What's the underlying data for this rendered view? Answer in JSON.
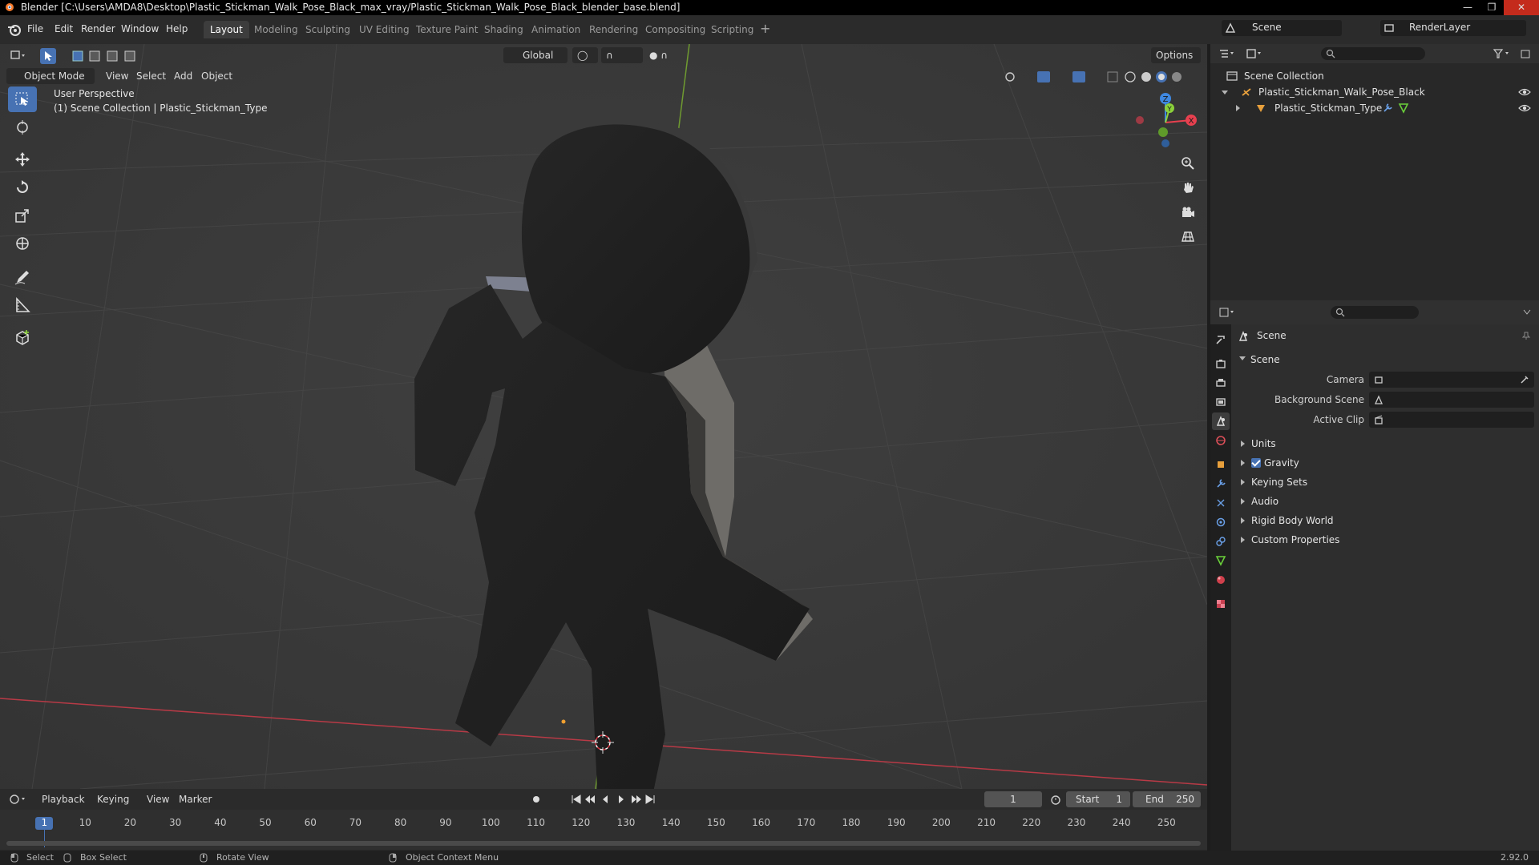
{
  "window": {
    "title": "Blender [C:\\Users\\AMDA8\\Desktop\\Plastic_Stickman_Walk_Pose_Black_max_vray/Plastic_Stickman_Walk_Pose_Black_blender_base.blend]"
  },
  "menu": {
    "items": [
      "File",
      "Edit",
      "Render",
      "Window",
      "Help"
    ]
  },
  "workspaces": {
    "tabs": [
      "Layout",
      "Modeling",
      "Sculpting",
      "UV Editing",
      "Texture Paint",
      "Shading",
      "Animation",
      "Rendering",
      "Compositing",
      "Scripting"
    ],
    "active": "Layout"
  },
  "scene_selector": {
    "scene": "Scene",
    "view_layer": "RenderLayer"
  },
  "viewport": {
    "mode": "Object Mode",
    "menus": [
      "View",
      "Select",
      "Add",
      "Object"
    ],
    "transform_orientation": "Global",
    "options_label": "Options",
    "overlay_line1": "User Perspective",
    "overlay_line2": "(1) Scene Collection | Plastic_Stickman_Type",
    "gizmo_axes": [
      "X",
      "Y",
      "Z"
    ]
  },
  "outliner": {
    "root": "Scene Collection",
    "items": [
      "Plastic_Stickman_Walk_Pose_Black",
      "Plastic_Stickman_Type"
    ]
  },
  "properties": {
    "context": "Scene",
    "panel": "Scene",
    "fields": {
      "camera": "Camera",
      "background_scene": "Background Scene",
      "active_clip": "Active Clip"
    },
    "sections": [
      "Units",
      "Gravity",
      "Keying Sets",
      "Audio",
      "Rigid Body World",
      "Custom Properties"
    ],
    "gravity_enabled": true
  },
  "timeline": {
    "menus": [
      "Playback",
      "Keying",
      "View",
      "Marker"
    ],
    "current_frame": "1",
    "start_label": "Start",
    "start": "1",
    "end_label": "End",
    "end": "250",
    "ruler": [
      "1",
      "10",
      "20",
      "30",
      "40",
      "50",
      "60",
      "70",
      "80",
      "90",
      "100",
      "110",
      "120",
      "130",
      "140",
      "150",
      "160",
      "170",
      "180",
      "190",
      "200",
      "210",
      "220",
      "230",
      "240",
      "250"
    ]
  },
  "statusbar": {
    "select": "Select",
    "box_select": "Box Select",
    "rotate_view": "Rotate View",
    "context_menu": "Object Context Menu",
    "version": "2.92.0"
  },
  "colors": {
    "accent": "#4772b3",
    "x_axis": "#e8404f",
    "y_axis": "#8bd13a",
    "z_axis": "#3f88e0"
  }
}
